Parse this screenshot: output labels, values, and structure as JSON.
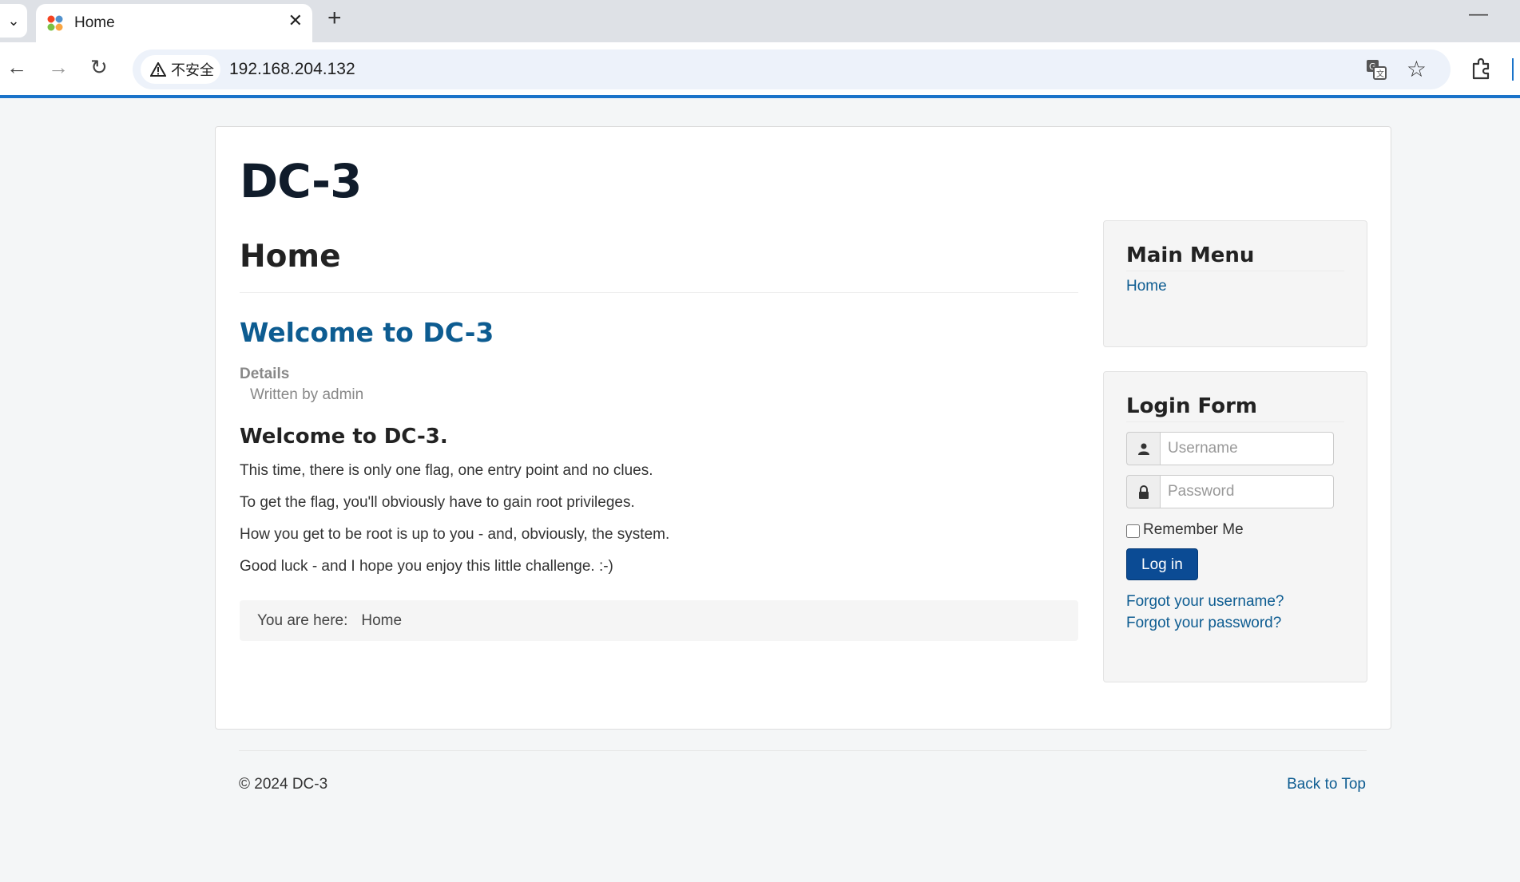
{
  "browser": {
    "tab": {
      "title": "Home",
      "favicon": "joomla-logo-icon"
    },
    "url": "192.168.204.132",
    "security_label": "不安全",
    "icons": [
      "tab-search-icon",
      "close-icon",
      "new-tab-icon",
      "minimize-icon",
      "back-arrow-icon",
      "forward-arrow-icon",
      "reload-icon",
      "warning-icon",
      "translate-icon",
      "star-icon",
      "extensions-icon"
    ],
    "accent_color": "#1a73c9"
  },
  "site": {
    "title": "DC-3",
    "page_header": "Home",
    "article": {
      "title": "Welcome to DC-3",
      "details_label": "Details",
      "written_by": "Written by admin",
      "subtitle": "Welcome to DC-3.",
      "paragraphs": [
        "This time, there is only one flag, one entry point and no clues.",
        "To get the flag, you'll obviously have to gain root privileges.",
        "How you get to be root is up to you - and, obviously, the system.",
        "Good luck - and I hope you enjoy this little challenge.  :-)"
      ]
    },
    "breadcrumb": {
      "label": "You are here:",
      "current": "Home"
    },
    "link_color": "#0d5c91"
  },
  "sidebar": {
    "main_menu": {
      "title": "Main Menu",
      "items": [
        "Home"
      ]
    },
    "login_form": {
      "title": "Login Form",
      "username_placeholder": "Username",
      "password_placeholder": "Password",
      "remember_label": "Remember Me",
      "remember_checked": false,
      "login_button": "Log in",
      "forgot_username": "Forgot your username?",
      "forgot_password": "Forgot your password?",
      "button_color": "#0b4b94"
    }
  },
  "footer": {
    "copyright": "© 2024 DC-3",
    "back_to_top": "Back to Top"
  }
}
